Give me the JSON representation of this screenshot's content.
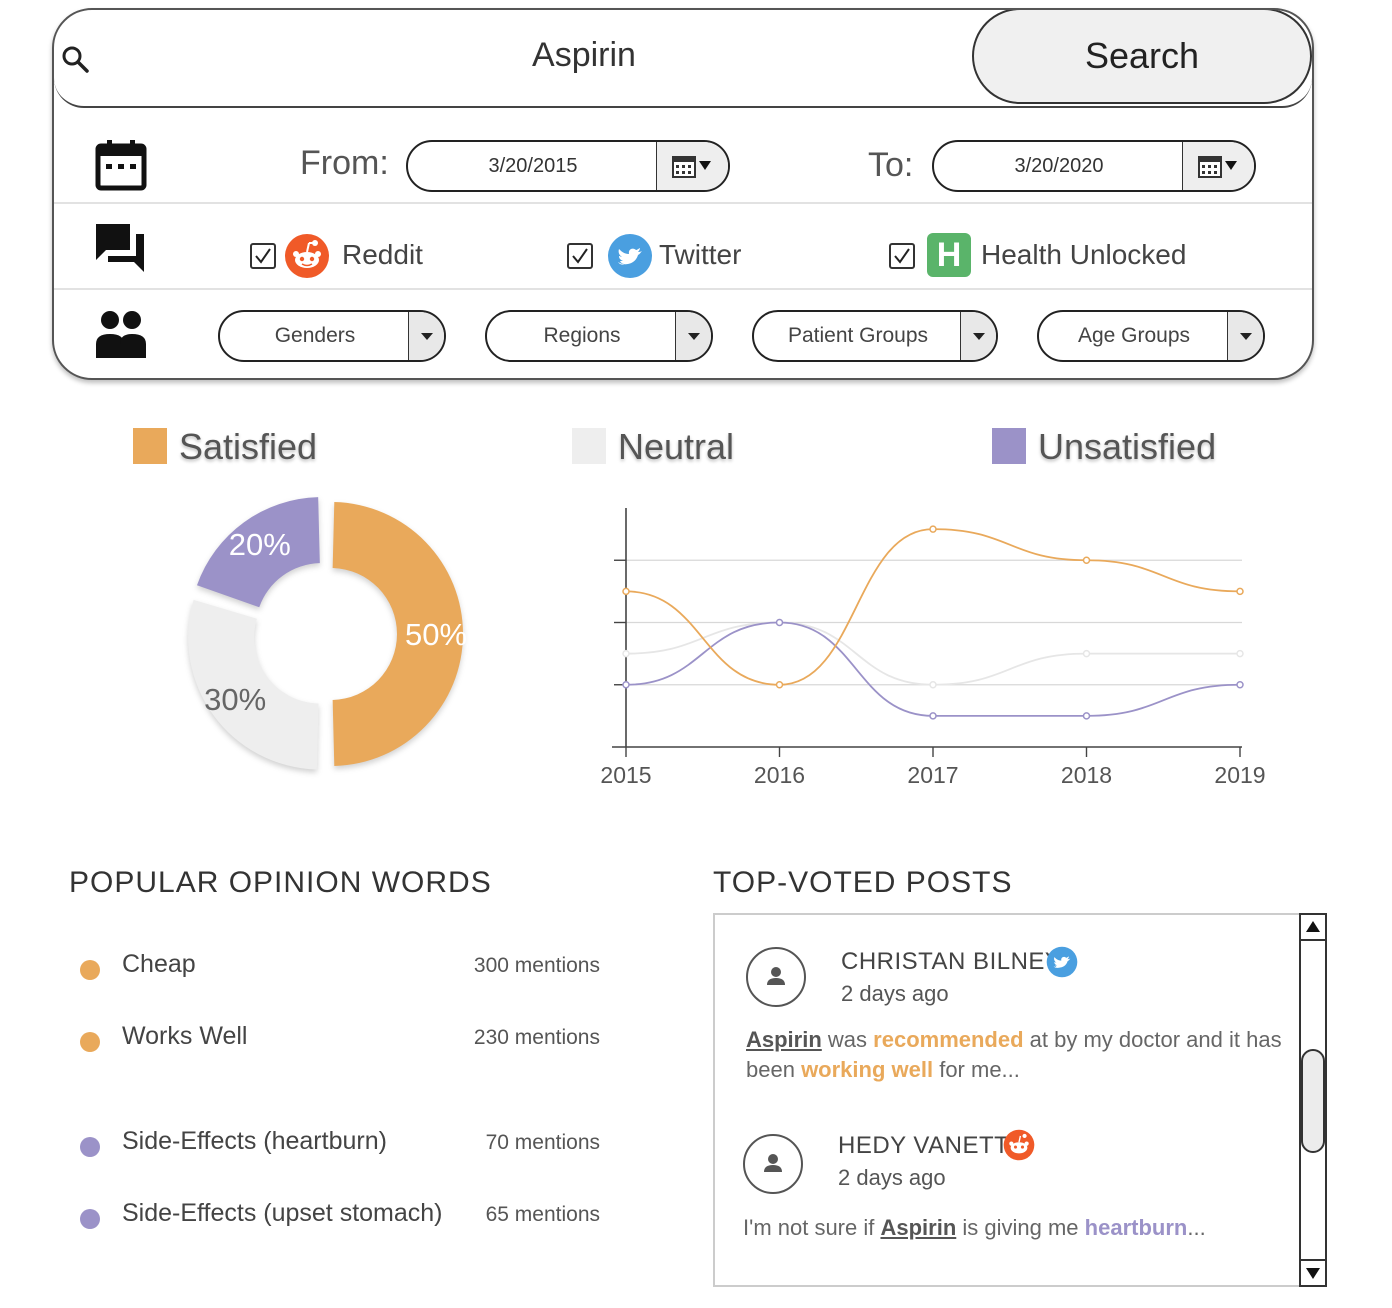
{
  "search": {
    "value": "Aspirin",
    "button_label": "Search"
  },
  "date_range": {
    "from_label": "From:",
    "from_value": "3/20/2015",
    "to_label": "To:",
    "to_value": "3/20/2020"
  },
  "sources": [
    {
      "label": "Reddit",
      "checked": true,
      "icon": "reddit-icon"
    },
    {
      "label": "Twitter",
      "checked": true,
      "icon": "twitter-icon"
    },
    {
      "label": "Health Unlocked",
      "checked": true,
      "icon": "health-unlocked-icon",
      "icon_letter": "H"
    }
  ],
  "filters": [
    "Genders",
    "Regions",
    "Patient Groups",
    "Age Groups"
  ],
  "legend": [
    {
      "label": "Satisfied",
      "color": "#e9a95b"
    },
    {
      "label": "Neutral",
      "color": "#eeeeee"
    },
    {
      "label": "Unsatisfied",
      "color": "#9b92c8"
    }
  ],
  "chart_data": [
    {
      "type": "pie",
      "labels": [
        "Satisfied",
        "Neutral",
        "Unsatisfied"
      ],
      "values": [
        50,
        30,
        20
      ],
      "value_labels": [
        "50%",
        "30%",
        "20%"
      ],
      "colors": [
        "#e9a95b",
        "#eeeeee",
        "#9b92c8"
      ],
      "donut": true
    },
    {
      "type": "line",
      "x": [
        "2015",
        "2016",
        "2017",
        "2018",
        "2019"
      ],
      "ylim": [
        0,
        4
      ],
      "grid": true,
      "series": [
        {
          "name": "Satisfied",
          "color": "#e9a95b",
          "values": [
            2.5,
            1.0,
            3.5,
            3.0,
            2.5
          ]
        },
        {
          "name": "Neutral",
          "color": "#e6e6e6",
          "values": [
            1.5,
            2.0,
            1.0,
            1.5,
            1.5
          ]
        },
        {
          "name": "Unsatisfied",
          "color": "#9b92c8",
          "values": [
            1.0,
            2.0,
            0.5,
            0.5,
            1.0
          ]
        }
      ]
    }
  ],
  "opinion_words": {
    "title": "POPULAR OPINION WORDS",
    "items": [
      {
        "word": "Cheap",
        "count": "300 mentions",
        "color": "#e9a95b"
      },
      {
        "word": "Works Well",
        "count": "230 mentions",
        "color": "#e9a95b"
      },
      {
        "word": "Side-Effects (heartburn)",
        "count": "70 mentions",
        "color": "#9b92c8"
      },
      {
        "word": "Side-Effects (upset stomach)",
        "count": "65 mentions",
        "color": "#9b92c8"
      }
    ]
  },
  "posts": {
    "title": "TOP-VOTED POSTS",
    "items": [
      {
        "author": "CHRISTAN BILNEY",
        "time": "2 days ago",
        "source_icon": "twitter-icon",
        "body": [
          {
            "t": "Aspirin",
            "k": "drug"
          },
          {
            "t": " was "
          },
          {
            "t": "recommended",
            "k": "pos"
          },
          {
            "t": " at by my doctor and it has been "
          },
          {
            "t": "working well",
            "k": "pos"
          },
          {
            "t": " for me..."
          }
        ]
      },
      {
        "author": "HEDY VANETTI",
        "time": "2 days ago",
        "source_icon": "reddit-icon",
        "body": [
          {
            "t": "I'm not sure if "
          },
          {
            "t": "Aspirin",
            "k": "drug"
          },
          {
            "t": " is giving me "
          },
          {
            "t": "heartburn",
            "k": "neg"
          },
          {
            "t": "..."
          }
        ]
      }
    ]
  }
}
